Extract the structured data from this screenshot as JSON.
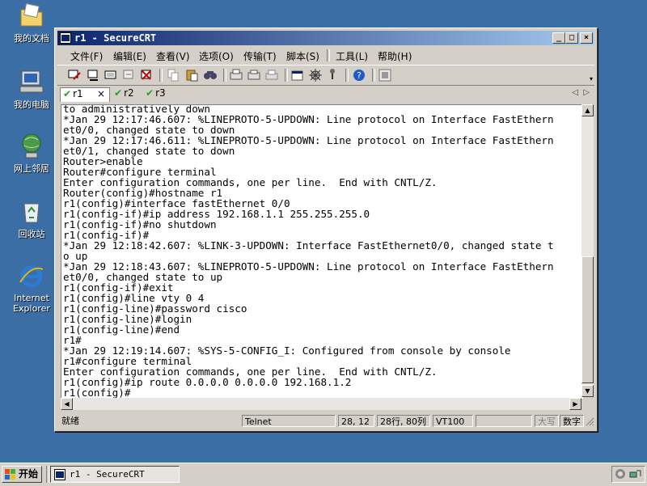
{
  "desktop": {
    "icons": [
      {
        "label": "我的文档",
        "icon": "my-documents-icon"
      },
      {
        "label": "我的电脑",
        "icon": "my-computer-icon"
      },
      {
        "label": "网上邻居",
        "icon": "network-places-icon"
      },
      {
        "label": "回收站",
        "icon": "recycle-bin-icon"
      },
      {
        "label": "Internet",
        "label2": "Explorer",
        "icon": "internet-explorer-icon"
      }
    ]
  },
  "window": {
    "title": "r1 - SecureCRT",
    "controls": {
      "minimize": "_",
      "maximize": "□",
      "close": "×"
    }
  },
  "menu": {
    "items": [
      "文件(F)",
      "编辑(E)",
      "查看(V)",
      "选项(O)",
      "传输(T)",
      "脚本(S)",
      "工具(L)",
      "帮助(H)"
    ]
  },
  "tabs": [
    {
      "label": "r1",
      "active": true,
      "close": "×"
    },
    {
      "label": "r2",
      "active": false
    },
    {
      "label": "r3",
      "active": false
    }
  ],
  "terminal": {
    "lines": [
      "to administratively down",
      "*Jan 29 12:17:46.607: %LINEPROTO-5-UPDOWN: Line protocol on Interface FastEthern",
      "et0/0, changed state to down",
      "*Jan 29 12:17:46.611: %LINEPROTO-5-UPDOWN: Line protocol on Interface FastEthern",
      "et0/1, changed state to down",
      "Router>enable",
      "Router#configure terminal",
      "Enter configuration commands, one per line.  End with CNTL/Z.",
      "Router(config)#hostname r1",
      "r1(config)#interface fastEthernet 0/0",
      "r1(config-if)#ip address 192.168.1.1 255.255.255.0",
      "r1(config-if)#no shutdown",
      "r1(config-if)#",
      "*Jan 29 12:18:42.607: %LINK-3-UPDOWN: Interface FastEthernet0/0, changed state t",
      "o up",
      "*Jan 29 12:18:43.607: %LINEPROTO-5-UPDOWN: Line protocol on Interface FastEthern",
      "et0/0, changed state to up",
      "r1(config-if)#exit",
      "r1(config)#line vty 0 4",
      "r1(config-line)#password cisco",
      "r1(config-line)#login",
      "r1(config-line)#end",
      "r1#",
      "*Jan 29 12:19:14.607: %SYS-5-CONFIG_I: Configured from console by console",
      "r1#configure terminal",
      "Enter configuration commands, one per line.  End with CNTL/Z.",
      "r1(config)#ip route 0.0.0.0 0.0.0.0 192.168.1.2",
      "r1(config)#"
    ]
  },
  "statusbar": {
    "ready": "就绪",
    "protocol": "Telnet",
    "cursor": "28, 12",
    "size": "28行, 80列",
    "emulation": "VT100",
    "caps": "大写",
    "num": "数字"
  },
  "taskbar": {
    "start": "开始",
    "window_button": "r1 - SecureCRT"
  },
  "colors": {
    "desktop": "#3a6ea5",
    "titlebar_start": "#0a246a",
    "titlebar_end": "#a6caf0",
    "chrome": "#d4d0c8"
  }
}
